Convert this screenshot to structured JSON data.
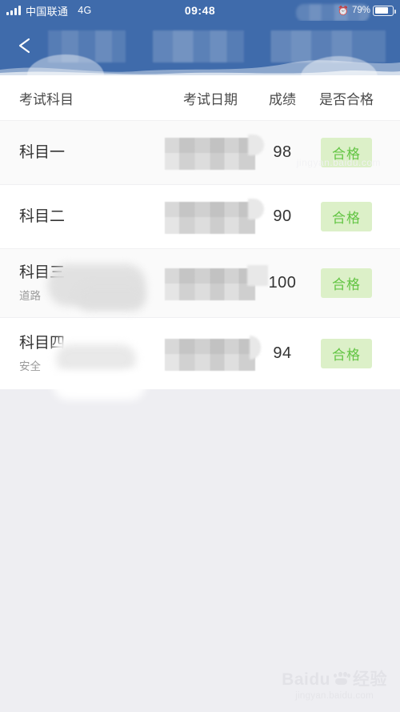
{
  "status_bar": {
    "carrier": "中国联通",
    "network": "4G",
    "time": "09:48",
    "battery_percent": "79%",
    "alarm_icon": "alarm-clock-icon",
    "signal_icon": "signal-bars-icon",
    "battery_icon": "battery-icon",
    "redacted_note": "blurred"
  },
  "navbar": {
    "back_icon": "chevron-left-icon",
    "title": "",
    "title_state": "blurred"
  },
  "table": {
    "headers": {
      "subject": "考试科目",
      "date": "考试日期",
      "score": "成绩",
      "pass": "是否合格"
    },
    "rows": [
      {
        "subject": "科目一",
        "subtitle": "",
        "date": "",
        "date_state": "blurred",
        "score": "98",
        "pass_label": "合格"
      },
      {
        "subject": "科目二",
        "subtitle": "",
        "date": "",
        "date_state": "blurred",
        "score": "90",
        "pass_label": "合格"
      },
      {
        "subject": "科目三",
        "subtitle": "道路",
        "date": "",
        "date_state": "blurred",
        "score": "100",
        "pass_label": "合格"
      },
      {
        "subject": "科目四",
        "subtitle": "安全",
        "date": "",
        "date_state": "blurred",
        "score": "94",
        "pass_label": "合格"
      }
    ]
  },
  "colors": {
    "header_blue": "#3f6bab",
    "badge_bg": "#dcf0c8",
    "badge_text": "#63c544",
    "page_bg": "#eeeef2",
    "sheet_bg": "#ffffff"
  },
  "watermark": {
    "brand": "Baidu",
    "brand_cn": "经验",
    "url": "jingyan.baidu.com",
    "paw_icon": "paw-print-icon"
  }
}
